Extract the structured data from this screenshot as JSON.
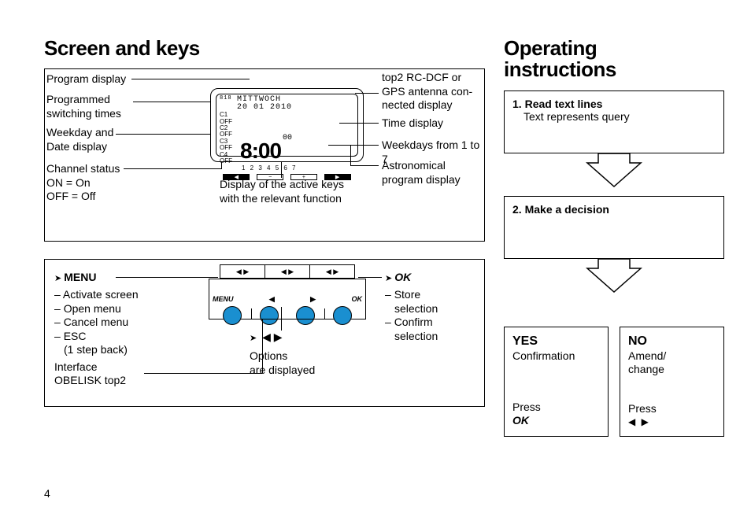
{
  "headings": {
    "left": "Screen and keys",
    "right_l1": "Operating",
    "right_l2": "instructions"
  },
  "page_number": "4",
  "lcd": {
    "dayname": "MITTWOCH",
    "date": "20 01 2010",
    "channels": [
      "C1 OFF",
      "C2 OFF",
      "C3 OFF",
      "C4 OFF"
    ],
    "time": "8:00",
    "seconds": "00",
    "weekday_marks": "1 2 3 4 5 6 7"
  },
  "diag1_left_labels": {
    "program_display": "Program display",
    "switching_l1": "Programmed",
    "switching_l2": "switching times",
    "weekday_l1": "Weekday and",
    "weekday_l2": "Date display",
    "channel_l1": "Channel status",
    "channel_l2": "ON = On",
    "channel_l3": "OFF = Off"
  },
  "diag1_right_labels": {
    "ant_l1": "top2 RC-DCF or",
    "ant_l2": "GPS antenna con-",
    "ant_l3": "nected display",
    "time_display": "Time display",
    "weekdays": "Weekdays from 1 to 7",
    "astro_l1": "Astronomical",
    "astro_l2": "program display"
  },
  "diag1_bottom": {
    "l1": "Display of the active keys",
    "l2": "with the relevant function"
  },
  "diag2": {
    "menu": "MENU",
    "ok": "OK",
    "menu_items": {
      "activate": "Activate screen",
      "open": "Open menu",
      "cancel": "Cancel menu",
      "esc": "ESC",
      "esc_sub": "(1 step back)"
    },
    "interface_l1": "Interface",
    "interface_l2": "OBELISK top2",
    "ok_items": {
      "store_l1": "Store",
      "store_l2": "selection",
      "confirm_l1": "Confirm",
      "confirm_l2": "selection"
    },
    "options_l1": "Options",
    "options_l2": "are displayed",
    "key_menu": "MENU",
    "key_ok": "OK"
  },
  "opsteps": {
    "s1_num": "1.",
    "s1_title": "Read text lines",
    "s1_sub": "Text represents query",
    "s2_num": "2.",
    "s2_title": "Make a decision"
  },
  "yesno": {
    "yes": "YES",
    "yes_sub": "Confirmation",
    "no": "NO",
    "no_sub_l1": "Amend/",
    "no_sub_l2": "change",
    "press": "Press",
    "ok": "OK",
    "arrows": "◀ ▶"
  }
}
